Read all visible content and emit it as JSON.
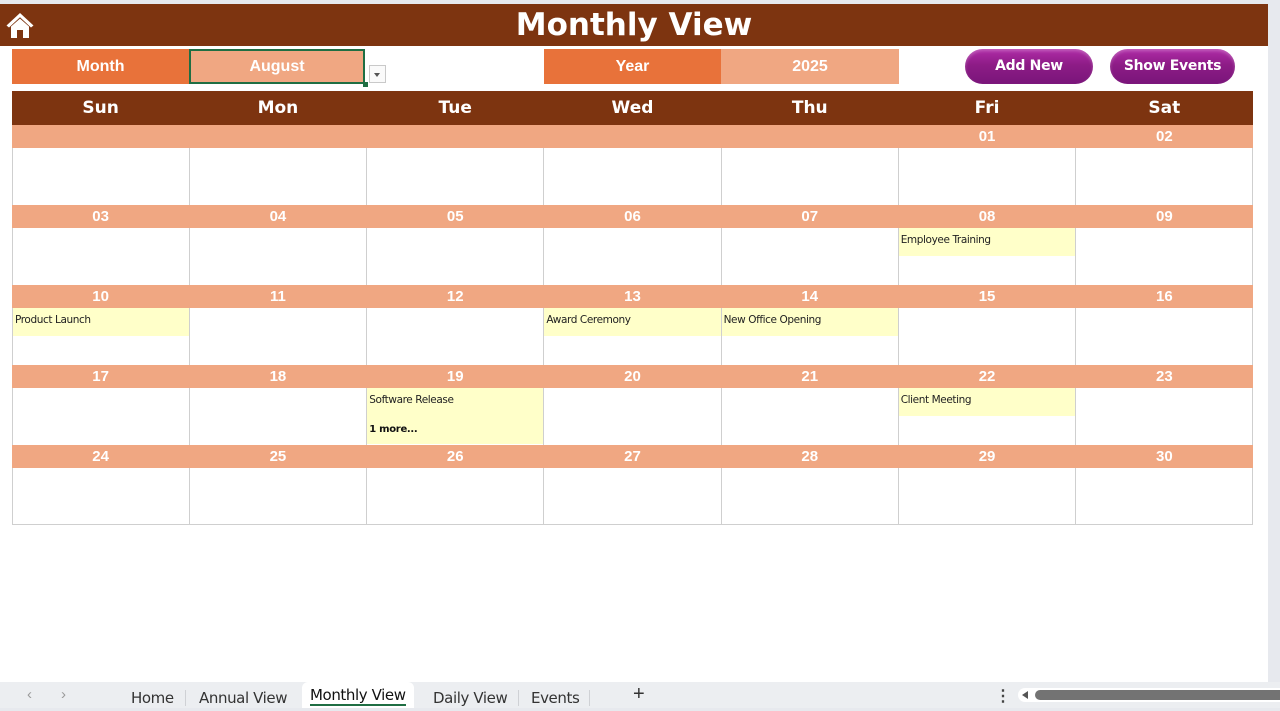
{
  "header": {
    "title": "Monthly View",
    "home_icon": "home-icon"
  },
  "controls": {
    "month_label": "Month",
    "month_value": "August",
    "year_label": "Year",
    "year_value": "2025",
    "add_new_label": "Add New",
    "show_events_label": "Show Events"
  },
  "colors": {
    "header_brown": "#7d3410",
    "label_orange": "#e8723a",
    "value_peach": "#f0a782",
    "event_yellow": "#ffffc9",
    "button_purple": "#8d1c86",
    "selection_green": "#1f6e43"
  },
  "calendar": {
    "weekdays": [
      "Sun",
      "Mon",
      "Tue",
      "Wed",
      "Thu",
      "Fri",
      "Sat"
    ],
    "weeks": [
      {
        "dates": [
          "",
          "",
          "",
          "",
          "",
          "01",
          "02"
        ],
        "events": [
          "",
          "",
          "",
          "",
          "",
          "",
          ""
        ],
        "more": [
          "",
          "",
          "",
          "",
          "",
          "",
          ""
        ]
      },
      {
        "dates": [
          "03",
          "04",
          "05",
          "06",
          "07",
          "08",
          "09"
        ],
        "events": [
          "",
          "",
          "",
          "",
          "",
          "Employee Training",
          ""
        ],
        "more": [
          "",
          "",
          "",
          "",
          "",
          "",
          ""
        ]
      },
      {
        "dates": [
          "10",
          "11",
          "12",
          "13",
          "14",
          "15",
          "16"
        ],
        "events": [
          "Product Launch",
          "",
          "",
          "Award Ceremony",
          "New Office Opening",
          "",
          ""
        ],
        "more": [
          "",
          "",
          "",
          "",
          "",
          "",
          ""
        ]
      },
      {
        "dates": [
          "17",
          "18",
          "19",
          "20",
          "21",
          "22",
          "23"
        ],
        "events": [
          "",
          "",
          "Software Release",
          "",
          "",
          "Client Meeting",
          ""
        ],
        "more": [
          "",
          "",
          "1 more...",
          "",
          "",
          "",
          ""
        ]
      },
      {
        "dates": [
          "24",
          "25",
          "26",
          "27",
          "28",
          "29",
          "30"
        ],
        "events": [
          "",
          "",
          "",
          "",
          "",
          "",
          ""
        ],
        "more": [
          "",
          "",
          "",
          "",
          "",
          "",
          ""
        ]
      }
    ]
  },
  "sheet_tabs": {
    "prev_icon": "‹",
    "next_icon": "›",
    "tabs": [
      "Home",
      "Annual View",
      "Monthly View",
      "Daily View",
      "Events"
    ],
    "active": "Monthly View",
    "add_icon": "+",
    "more_icon": "⋮"
  }
}
